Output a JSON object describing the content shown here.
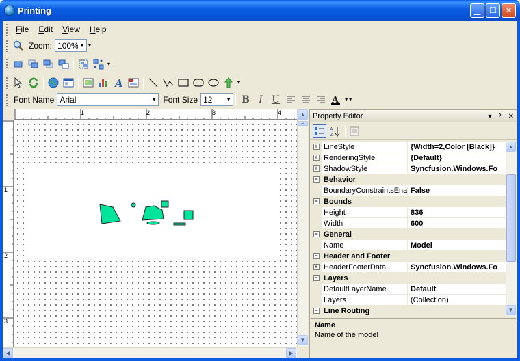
{
  "window": {
    "title": "Printing"
  },
  "menu": [
    {
      "label": "File",
      "key": "F",
      "rest": "ile"
    },
    {
      "label": "Edit",
      "key": "E",
      "rest": "dit"
    },
    {
      "label": "View",
      "key": "V",
      "rest": "iew"
    },
    {
      "label": "Help",
      "key": "H",
      "rest": "elp"
    }
  ],
  "zoom": {
    "label": "Zoom:",
    "value": "100%"
  },
  "font": {
    "name_label": "Font Name",
    "name_value": "Arial",
    "size_label": "Font Size",
    "size_value": "12"
  },
  "format_buttons": [
    "B",
    "I",
    "U"
  ],
  "rulers": {
    "top": [
      "1",
      "2",
      "3",
      "4"
    ],
    "left": [
      "1",
      "2",
      "3"
    ]
  },
  "property_editor": {
    "title": "Property Editor",
    "rows": [
      {
        "type": "prop",
        "expand": true,
        "name": "LineStyle",
        "value": "{Width=2,Color [Black]}",
        "bold": true
      },
      {
        "type": "prop",
        "expand": true,
        "name": "RenderingStyle",
        "value": "{Default}",
        "bold": true
      },
      {
        "type": "prop",
        "expand": true,
        "name": "ShadowStyle",
        "value": "Syncfusion.Windows.Fo",
        "bold": true
      },
      {
        "type": "cat",
        "name": "Behavior"
      },
      {
        "type": "prop",
        "expand": false,
        "name": "BoundaryConstraintsEnab",
        "value": "False",
        "bold": true
      },
      {
        "type": "cat",
        "name": "Bounds"
      },
      {
        "type": "prop",
        "expand": false,
        "name": "Height",
        "value": "836",
        "bold": true
      },
      {
        "type": "prop",
        "expand": false,
        "name": "Width",
        "value": "600",
        "bold": true
      },
      {
        "type": "cat",
        "name": "General"
      },
      {
        "type": "prop",
        "expand": false,
        "name": "Name",
        "value": "Model",
        "bold": true
      },
      {
        "type": "cat",
        "name": "Header and Footer"
      },
      {
        "type": "prop",
        "expand": true,
        "name": "HeaderFooterData",
        "value": "Syncfusion.Windows.Fo",
        "bold": true
      },
      {
        "type": "cat",
        "name": "Layers"
      },
      {
        "type": "prop",
        "expand": false,
        "name": "DefaultLayerName",
        "value": "Default",
        "bold": true
      },
      {
        "type": "prop",
        "expand": false,
        "name": "Layers",
        "value": "(Collection)",
        "bold": false
      },
      {
        "type": "cat",
        "name": "Line Routing"
      }
    ],
    "description": {
      "title": "Name",
      "text": "Name of the model"
    }
  },
  "colors": {
    "shape_fill": "#00e59a",
    "titlebar": "#0a5ce8"
  },
  "icons": [
    "zoom-icon",
    "bring-front-icon",
    "send-back-icon",
    "select-icon",
    "rotate-icon",
    "globe-icon",
    "image-icon",
    "chart-icon",
    "text-icon",
    "line-icon",
    "polyline-icon",
    "rectangle-icon",
    "rounded-rect-icon",
    "ellipse-icon",
    "arrow-icon",
    "font-color-icon"
  ]
}
